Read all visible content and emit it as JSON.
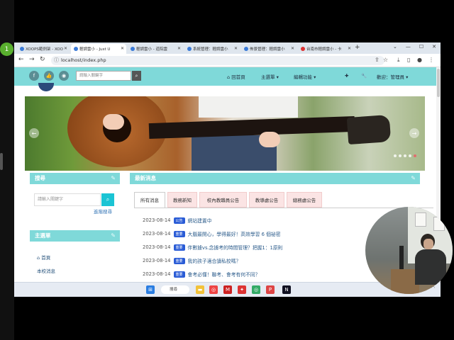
{
  "rail": {
    "badge": "1"
  },
  "browser": {
    "tabs": [
      {
        "label": "XOOPS範例架 - XOO"
      },
      {
        "label": "輕調雲小 - Just U"
      },
      {
        "label": "輕調雲小 - 道院雲"
      },
      {
        "label": "系統管理：輕調雲小"
      },
      {
        "label": "佈景管理：輕調雲小"
      },
      {
        "label": "台南市輕調雲小 - 卡"
      }
    ],
    "url": "localhost/index.php"
  },
  "site": {
    "nav": {
      "search_placeholder": "請輸入關鍵字",
      "home": "回首頁",
      "main_menu": "主選單",
      "edit": "編輯功能",
      "welcome": "歡迎：管理員"
    },
    "sidebar": {
      "search_title": "搜尋",
      "search_placeholder": "請輸入關鍵字",
      "adv_search": "進階搜尋",
      "menu_title": "主選單",
      "menu_items": [
        "首頁",
        "本校消息"
      ]
    },
    "news": {
      "title": "最新消息",
      "tabs": [
        "所有消息",
        "教務新知",
        "校內教職員公告",
        "教導處公告",
        "總務處公告"
      ],
      "items": [
        {
          "date": "2023-08-14",
          "badge": "公告",
          "title": "網站建置中"
        },
        {
          "date": "2023-08-14",
          "badge": "重要",
          "title": "大腦最開心，學得最好！高效學習 6 個祕密"
        },
        {
          "date": "2023-08-14",
          "badge": "重要",
          "title": "伴數據vs.念據考的時間管理？把握1：1原則"
        },
        {
          "date": "2023-08-14",
          "badge": "重要",
          "title": "我的孩子適合讀私校嗎？"
        },
        {
          "date": "2023-08-14",
          "badge": "重要",
          "title": "會考必懂！聯考、會考有何不同？"
        }
      ]
    }
  },
  "taskbar": {
    "search": "搜尋"
  },
  "colors": {
    "accent": "#7fd9d9",
    "badge_notice": "#2a5cd6",
    "badge_important": "#2a5cd6",
    "tab_bg": "#fbe4e4"
  }
}
